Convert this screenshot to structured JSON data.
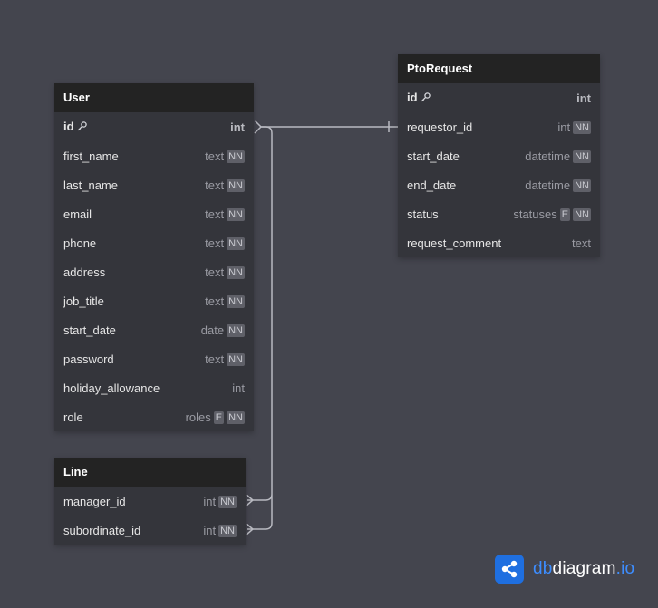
{
  "tables": {
    "user": {
      "name": "User",
      "fields": [
        {
          "name": "id",
          "type": "int",
          "badges": [],
          "pk": true
        },
        {
          "name": "first_name",
          "type": "text",
          "badges": [
            "NN"
          ]
        },
        {
          "name": "last_name",
          "type": "text",
          "badges": [
            "NN"
          ]
        },
        {
          "name": "email",
          "type": "text",
          "badges": [
            "NN"
          ]
        },
        {
          "name": "phone",
          "type": "text",
          "badges": [
            "NN"
          ]
        },
        {
          "name": "address",
          "type": "text",
          "badges": [
            "NN"
          ]
        },
        {
          "name": "job_title",
          "type": "text",
          "badges": [
            "NN"
          ]
        },
        {
          "name": "start_date",
          "type": "date",
          "badges": [
            "NN"
          ]
        },
        {
          "name": "password",
          "type": "text",
          "badges": [
            "NN"
          ]
        },
        {
          "name": "holiday_allowance",
          "type": "int",
          "badges": []
        },
        {
          "name": "role",
          "type": "roles",
          "badges": [
            "E",
            "NN"
          ]
        }
      ]
    },
    "pto_request": {
      "name": "PtoRequest",
      "fields": [
        {
          "name": "id",
          "type": "int",
          "badges": [],
          "pk": true
        },
        {
          "name": "requestor_id",
          "type": "int",
          "badges": [
            "NN"
          ]
        },
        {
          "name": "start_date",
          "type": "datetime",
          "badges": [
            "NN"
          ]
        },
        {
          "name": "end_date",
          "type": "datetime",
          "badges": [
            "NN"
          ]
        },
        {
          "name": "status",
          "type": "statuses",
          "badges": [
            "E",
            "NN"
          ]
        },
        {
          "name": "request_comment",
          "type": "text",
          "badges": []
        }
      ]
    },
    "line": {
      "name": "Line",
      "fields": [
        {
          "name": "manager_id",
          "type": "int",
          "badges": [
            "NN"
          ]
        },
        {
          "name": "subordinate_id",
          "type": "int",
          "badges": [
            "NN"
          ]
        }
      ]
    }
  },
  "brand": {
    "part1": "db",
    "part2": "diagram",
    "part3": ".io"
  },
  "icons": {
    "primary_key": "key-icon",
    "brand": "share-network-icon"
  },
  "colors": {
    "background": "#44454e",
    "header": "#232323",
    "body": "#34353b",
    "link": "#b8b9c0",
    "brand_blue": "#1f6fe0"
  }
}
